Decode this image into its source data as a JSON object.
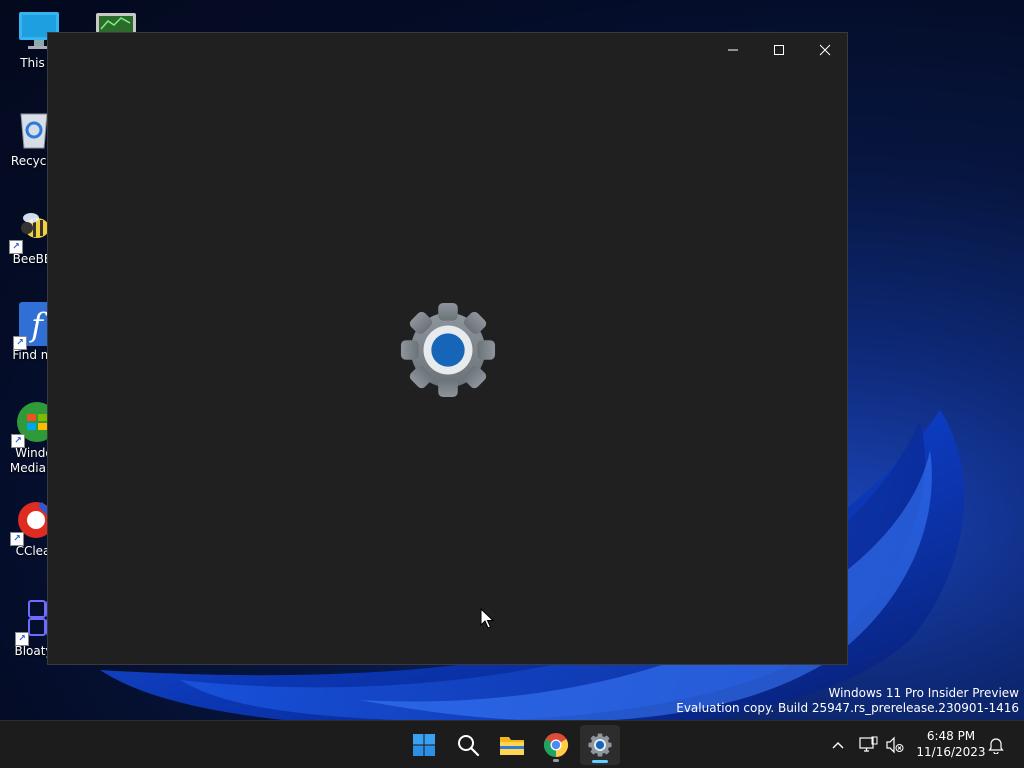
{
  "desktop": {
    "icons": [
      {
        "label": "This PC",
        "visible_text": "This P"
      },
      {
        "label": "Recycle Bin",
        "visible_text": "Recycle"
      },
      {
        "label": "BeeBEEP",
        "visible_text": "BeeBE"
      },
      {
        "label": "Find my Font",
        "visible_text": "Find my"
      },
      {
        "label": "Windows Media Center",
        "line1": "Windo",
        "line2": "Media C"
      },
      {
        "label": "CCleaner",
        "visible_text": "CClea"
      },
      {
        "label": "BloatyNosy",
        "visible_text": "BloatyN"
      }
    ]
  },
  "window": {
    "app": "Settings",
    "state": "loading splash",
    "minimize_label": "Minimize",
    "maximize_label": "Maximize",
    "close_label": "Close"
  },
  "watermark": {
    "line1": "Windows 11 Pro Insider Preview",
    "line2": "Evaluation copy. Build 25947.rs_prerelease.230901-1416"
  },
  "taskbar": {
    "items": [
      "start-icon",
      "search-icon",
      "file-explorer-icon",
      "chrome-icon",
      "settings-icon"
    ],
    "active_item": "settings-icon",
    "tray": {
      "time": "6:48 PM",
      "date": "11/16/2023"
    }
  },
  "colors": {
    "window_bg": "#202020",
    "taskbar_bg": "#1c1c1c",
    "accent": "#60cdff",
    "gear_center": "#1765b8"
  }
}
